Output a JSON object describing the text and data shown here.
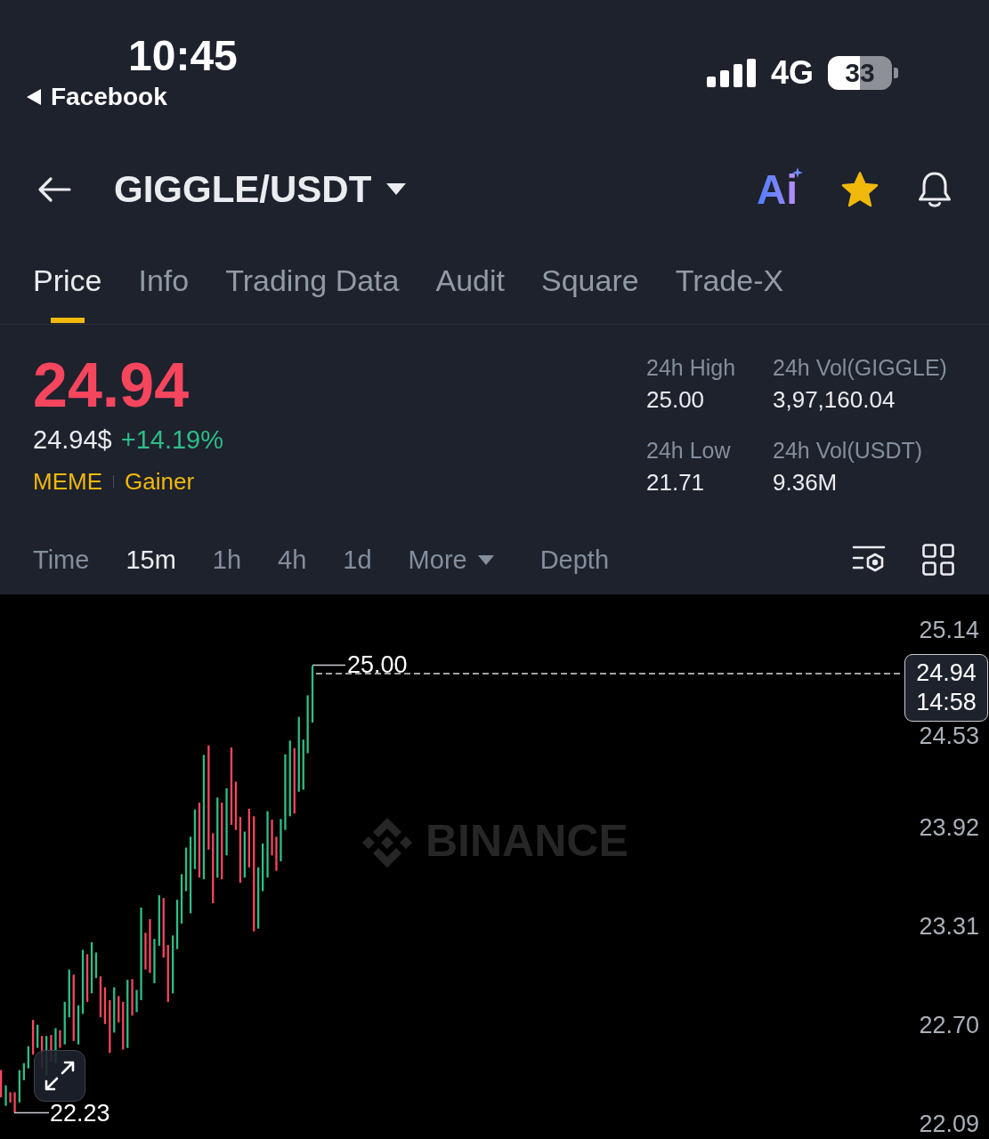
{
  "status_bar": {
    "time": "10:45",
    "back_app": "Facebook",
    "network": "4G",
    "battery": "33"
  },
  "header": {
    "pair": "GIGGLE/USDT",
    "ai_label": "Ai",
    "favorite": true
  },
  "tabs": [
    {
      "label": "Price",
      "selected": true
    },
    {
      "label": "Info",
      "selected": false
    },
    {
      "label": "Trading Data",
      "selected": false
    },
    {
      "label": "Audit",
      "selected": false
    },
    {
      "label": "Square",
      "selected": false
    },
    {
      "label": "Trade-X",
      "selected": false
    }
  ],
  "price": {
    "last": "24.94",
    "last_rising": false,
    "usd": "24.94$",
    "change": "+14.19%",
    "change_rising": true,
    "tags": [
      "MEME",
      "Gainer"
    ]
  },
  "stats": [
    {
      "label": "24h High",
      "value": "25.00"
    },
    {
      "label": "24h Vol(GIGGLE)",
      "value": "3,97,160.04"
    },
    {
      "label": "24h Low",
      "value": "21.71"
    },
    {
      "label": "24h Vol(USDT)",
      "value": "9.36M"
    }
  ],
  "intervals": [
    {
      "label": "Time",
      "kind": "option",
      "selected": false
    },
    {
      "label": "15m",
      "kind": "option",
      "selected": true
    },
    {
      "label": "1h",
      "kind": "option",
      "selected": false
    },
    {
      "label": "4h",
      "kind": "option",
      "selected": false
    },
    {
      "label": "1d",
      "kind": "option",
      "selected": false
    },
    {
      "label": "More",
      "kind": "dropdown",
      "selected": false
    },
    {
      "label": "Depth",
      "kind": "view",
      "selected": false
    }
  ],
  "chart": {
    "axis_labels": [
      "25.14",
      "24.53",
      "23.92",
      "23.31",
      "22.70",
      "22.09"
    ],
    "high_label": "25.00",
    "low_label": "22.23",
    "last_price": "24.94",
    "countdown": "14:58",
    "watermark": "BINANCE"
  }
}
